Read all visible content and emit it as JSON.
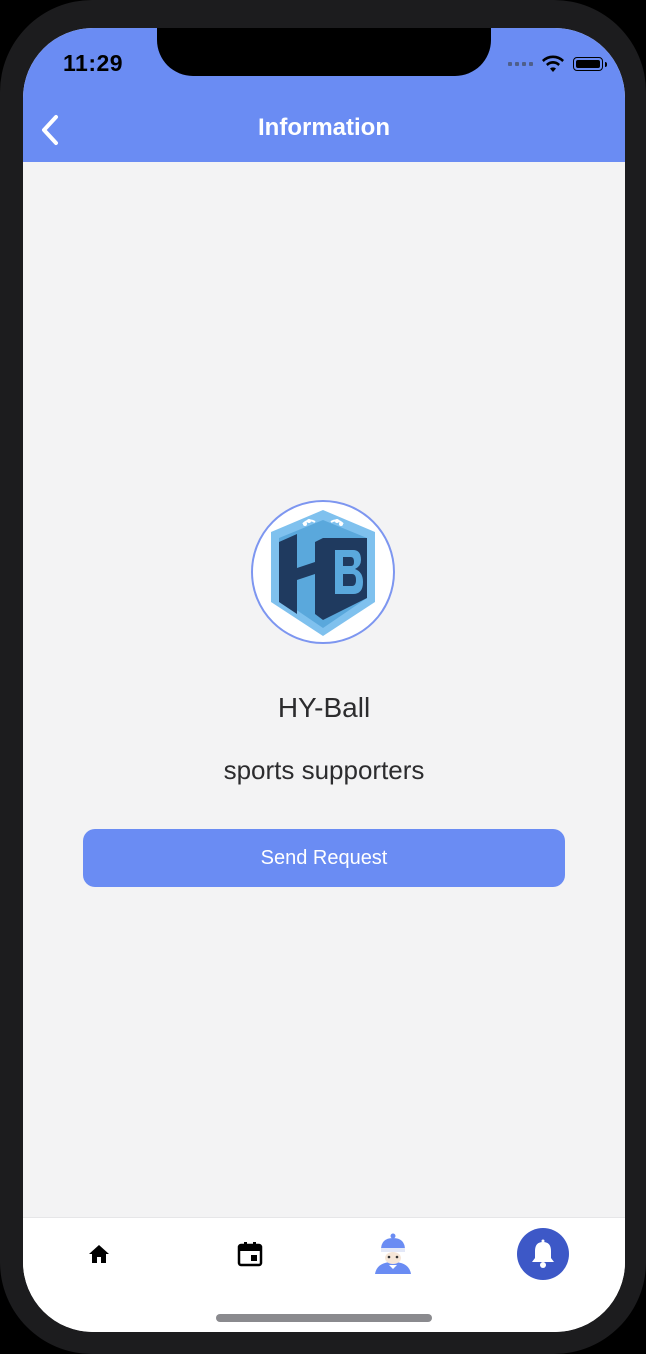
{
  "status_bar": {
    "time": "11:29"
  },
  "header": {
    "title": "Information",
    "back_icon": "chevron-left-icon",
    "background_color": "#6a8cf3"
  },
  "profile": {
    "logo_icon": "hyball-crest-icon",
    "name": "HY-Ball",
    "description": "sports supporters"
  },
  "actions": {
    "send_request_label": "Send Request",
    "accent_color": "#6a8cf3"
  },
  "tabbar": {
    "items": [
      {
        "id": "home",
        "icon": "home-icon"
      },
      {
        "id": "calendar",
        "icon": "calendar-icon"
      },
      {
        "id": "profile",
        "icon": "avatar-icon"
      },
      {
        "id": "notifications",
        "icon": "bell-icon",
        "active": true
      }
    ]
  }
}
